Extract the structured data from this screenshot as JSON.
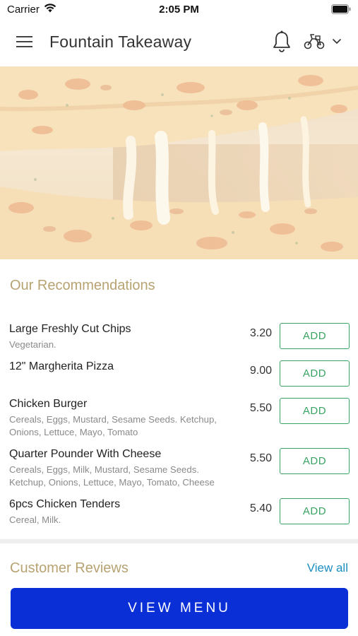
{
  "status_bar": {
    "carrier": "Carrier",
    "time": "2:05 PM"
  },
  "header": {
    "title": "Fountain Takeaway"
  },
  "hero": {
    "image": "melted-cheese-pizza-slice"
  },
  "recommendations": {
    "title": "Our Recommendations",
    "add_label": "ADD",
    "items": [
      {
        "name": "Large Freshly Cut Chips",
        "description": "Vegetarian.",
        "price": "3.20"
      },
      {
        "name": "12\" Margherita Pizza",
        "description": "",
        "price": "9.00"
      },
      {
        "name": "Chicken Burger",
        "description": "Cereals, Eggs, Mustard, Sesame Seeds. Ketchup, Onions, Lettuce, Mayo, Tomato",
        "price": "5.50"
      },
      {
        "name": "Quarter Pounder With Cheese",
        "description": "Cereals, Eggs, Milk, Mustard, Sesame Seeds. Ketchup, Onions, Lettuce, Mayo, Tomato, Cheese",
        "price": "5.50"
      },
      {
        "name": "6pcs Chicken Tenders",
        "description": "Cereal, Milk.",
        "price": "5.40"
      }
    ]
  },
  "reviews": {
    "title": "Customer Reviews",
    "view_all": "View all"
  },
  "footer": {
    "view_menu": "VIEW MENU"
  },
  "colors": {
    "accent_gold": "#b7a272",
    "add_green": "#3aa363",
    "link_blue": "#1c8fc0",
    "primary_button": "#0a2fd6"
  },
  "icons": [
    "wifi-icon",
    "battery-icon",
    "hamburger-menu-icon",
    "bell-icon",
    "scooter-icon",
    "chevron-down-icon"
  ]
}
